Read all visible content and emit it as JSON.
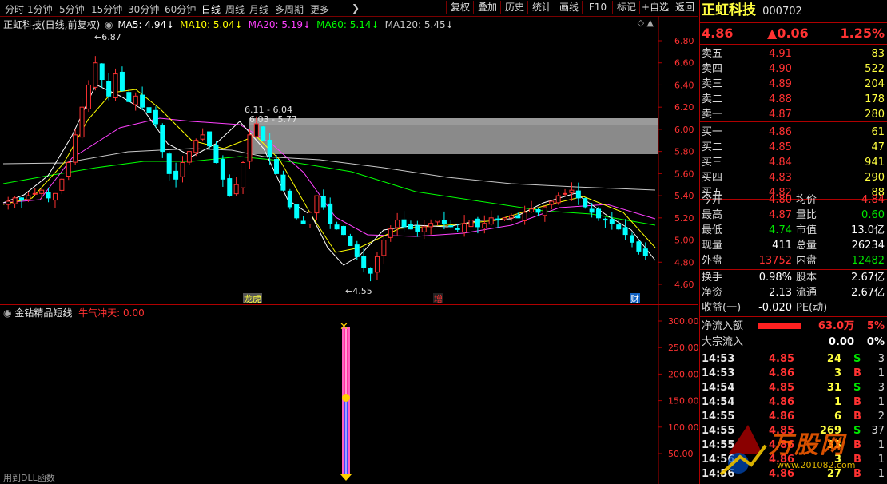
{
  "toolbar": {
    "periods": [
      "分时",
      "1分钟",
      "5分钟",
      "15分钟",
      "30分钟",
      "60分钟",
      "日线",
      "周线",
      "月线",
      "多周期",
      "更多"
    ],
    "active_period": "日线",
    "buttons": [
      "复权",
      "叠加",
      "历史",
      "统计",
      "画线",
      "F10",
      "标记",
      "+自选",
      "返回"
    ]
  },
  "kline": {
    "header_title": "正虹科技(日线,前复权)",
    "ma": [
      {
        "label": "MA5: 4.94",
        "color": "#ffffff"
      },
      {
        "label": "MA10: 5.04",
        "color": "#ffff00"
      },
      {
        "label": "MA20: 5.19",
        "color": "#ff40ff"
      },
      {
        "label": "MA60: 5.14",
        "color": "#00ff00"
      },
      {
        "label": "MA120: 5.45",
        "color": "#c8c8c8"
      }
    ],
    "y_ticks": [
      "6.80",
      "6.60",
      "6.40",
      "6.20",
      "6.00",
      "5.80",
      "5.60",
      "5.40",
      "5.20",
      "5.00",
      "4.80",
      "4.60"
    ],
    "high_label": "6.87",
    "low_label": "4.55",
    "zone_label_1": "6.11 - 6.04",
    "zone_label_2": "6.03 - 5.77",
    "markers": [
      "龙虎",
      "增",
      "财"
    ]
  },
  "indicator": {
    "title": "金钻精品短线",
    "subtitle": "牛气冲天: 0.00",
    "y_ticks": [
      "300.00",
      "250.00",
      "200.00",
      "150.00",
      "100.00",
      "50.00"
    ],
    "footer": "用到DLL函数"
  },
  "quote": {
    "name": "正虹科技",
    "code": "000702",
    "price": "4.86",
    "change": "▲0.06",
    "pct": "1.25%",
    "asks": [
      {
        "label": "卖五",
        "price": "4.91",
        "vol": "83"
      },
      {
        "label": "卖四",
        "price": "4.90",
        "vol": "522"
      },
      {
        "label": "卖三",
        "price": "4.89",
        "vol": "204"
      },
      {
        "label": "卖二",
        "price": "4.88",
        "vol": "178"
      },
      {
        "label": "卖一",
        "price": "4.87",
        "vol": "280"
      }
    ],
    "bids": [
      {
        "label": "买一",
        "price": "4.86",
        "vol": "61"
      },
      {
        "label": "买二",
        "price": "4.85",
        "vol": "47"
      },
      {
        "label": "买三",
        "price": "4.84",
        "vol": "941"
      },
      {
        "label": "买四",
        "price": "4.83",
        "vol": "290"
      },
      {
        "label": "买五",
        "price": "4.82",
        "vol": "88"
      }
    ],
    "stats": [
      {
        "l1": "今开",
        "v1": "4.80",
        "c1": "red",
        "l2": "均价",
        "v2": "4.84",
        "c2": "red"
      },
      {
        "l1": "最高",
        "v1": "4.87",
        "c1": "red",
        "l2": "量比",
        "v2": "0.60",
        "c2": "grn"
      },
      {
        "l1": "最低",
        "v1": "4.74",
        "c1": "grn",
        "l2": "市值",
        "v2": "13.0亿",
        "c2": "wht"
      },
      {
        "l1": "现量",
        "v1": "411",
        "c1": "wht",
        "l2": "总量",
        "v2": "26234",
        "c2": "wht"
      },
      {
        "l1": "外盘",
        "v1": "13752",
        "c1": "red",
        "l2": "内盘",
        "v2": "12482",
        "c2": "grn"
      }
    ],
    "stats2": [
      {
        "l1": "换手",
        "v1": "0.98%",
        "l2": "股本",
        "v2": "2.67亿"
      },
      {
        "l1": "净资",
        "v1": "2.13",
        "l2": "流通",
        "v2": "2.67亿"
      },
      {
        "l1": "收益(一)",
        "v1": "-0.020",
        "l2": "PE(动)",
        "v2": ""
      }
    ],
    "flow": [
      {
        "label": "净流入额",
        "value": "63.0万",
        "pct": "5%"
      },
      {
        "label": "大宗流入",
        "value": "0.00",
        "pct": "0%"
      }
    ],
    "ticks": [
      {
        "time": "14:53",
        "price": "4.85",
        "vol": "24",
        "bs": "S",
        "n": "3"
      },
      {
        "time": "14:53",
        "price": "4.86",
        "vol": "3",
        "bs": "B",
        "n": "1"
      },
      {
        "time": "14:54",
        "price": "4.85",
        "vol": "31",
        "bs": "S",
        "n": "3"
      },
      {
        "time": "14:54",
        "price": "4.86",
        "vol": "1",
        "bs": "B",
        "n": "1"
      },
      {
        "time": "14:55",
        "price": "4.86",
        "vol": "6",
        "bs": "B",
        "n": "2"
      },
      {
        "time": "14:55",
        "price": "4.85",
        "vol": "269",
        "bs": "S",
        "n": "37"
      },
      {
        "time": "14:55",
        "price": "4.86",
        "vol": "33",
        "bs": "B",
        "n": "1"
      },
      {
        "time": "14:56",
        "price": "4.86",
        "vol": "3",
        "bs": "B",
        "n": "1"
      },
      {
        "time": "14:56",
        "price": "4.86",
        "vol": "27",
        "bs": "B",
        "n": "1"
      }
    ],
    "watermark": "万股网",
    "watermark_url": "www.201082.com"
  },
  "colors": {
    "up": "#ff3232",
    "down": "#00ffff",
    "frame": "#b00000"
  }
}
